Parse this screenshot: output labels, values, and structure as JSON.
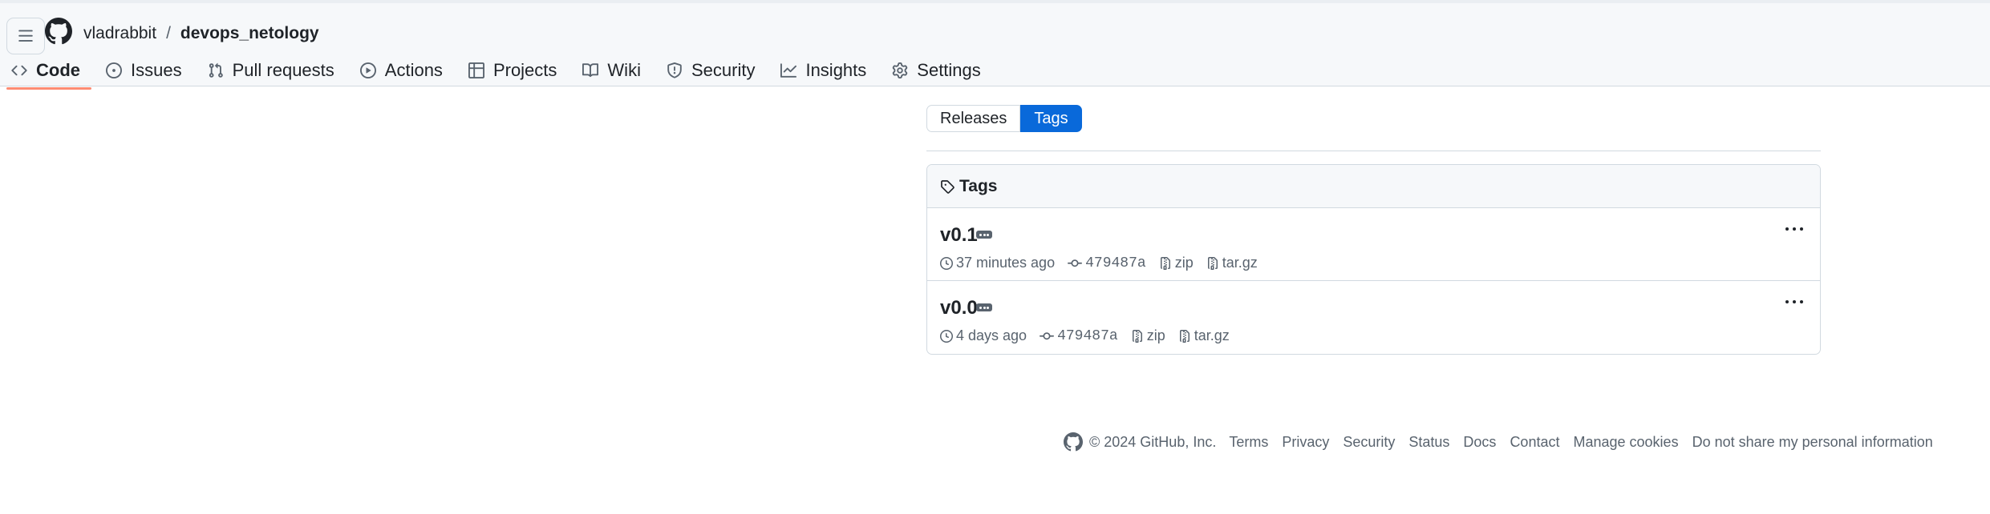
{
  "header": {
    "owner": "vladrabbit",
    "separator": "/",
    "repo": "devops_netology"
  },
  "nav": {
    "tabs": [
      {
        "label": "Code",
        "icon": "code-icon",
        "active": true
      },
      {
        "label": "Issues",
        "icon": "issue-opened-icon"
      },
      {
        "label": "Pull requests",
        "icon": "git-pull-request-icon"
      },
      {
        "label": "Actions",
        "icon": "play-icon"
      },
      {
        "label": "Projects",
        "icon": "table-icon"
      },
      {
        "label": "Wiki",
        "icon": "book-icon"
      },
      {
        "label": "Security",
        "icon": "shield-icon"
      },
      {
        "label": "Insights",
        "icon": "graph-icon"
      },
      {
        "label": "Settings",
        "icon": "gear-icon"
      }
    ]
  },
  "subnav": {
    "releases": "Releases",
    "tags": "Tags",
    "selected": "Tags"
  },
  "tags_box": {
    "title": "Tags",
    "items": [
      {
        "name": "v0.1",
        "time": "37 minutes ago",
        "commit": "479487a",
        "zip": "zip",
        "targz": "tar.gz"
      },
      {
        "name": "v0.0",
        "time": "4 days ago",
        "commit": "479487a",
        "zip": "zip",
        "targz": "tar.gz"
      }
    ]
  },
  "footer": {
    "copyright": "© 2024 GitHub, Inc.",
    "links": [
      "Terms",
      "Privacy",
      "Security",
      "Status",
      "Docs",
      "Contact",
      "Manage cookies",
      "Do not share my personal information"
    ]
  },
  "colors": {
    "accent": "#0969da",
    "active_underline": "#fd8c73",
    "header_bg": "#f6f8fa",
    "border": "#d1d9e0",
    "muted_text": "#59636e"
  }
}
